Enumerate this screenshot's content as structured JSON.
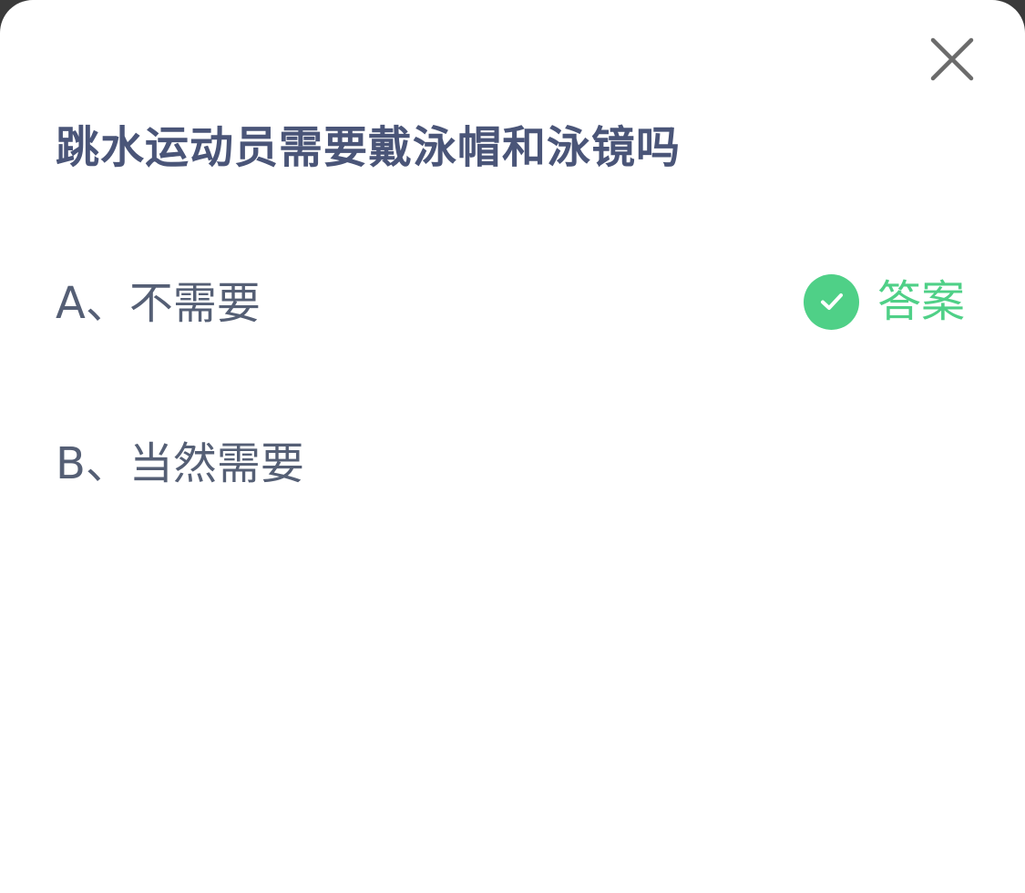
{
  "colors": {
    "question_text": "#4a5578",
    "option_text": "#555f75",
    "answer_green": "#4fd087",
    "close_icon": "#6b6b6b"
  },
  "question": {
    "text": "跳水运动员需要戴泳帽和泳镜吗"
  },
  "options": [
    {
      "label": "A、不需要",
      "is_answer": true
    },
    {
      "label": "B、当然需要",
      "is_answer": false
    }
  ],
  "answer_tag": {
    "label": "答案",
    "icon": "check-icon"
  },
  "close": {
    "icon": "close-icon"
  }
}
